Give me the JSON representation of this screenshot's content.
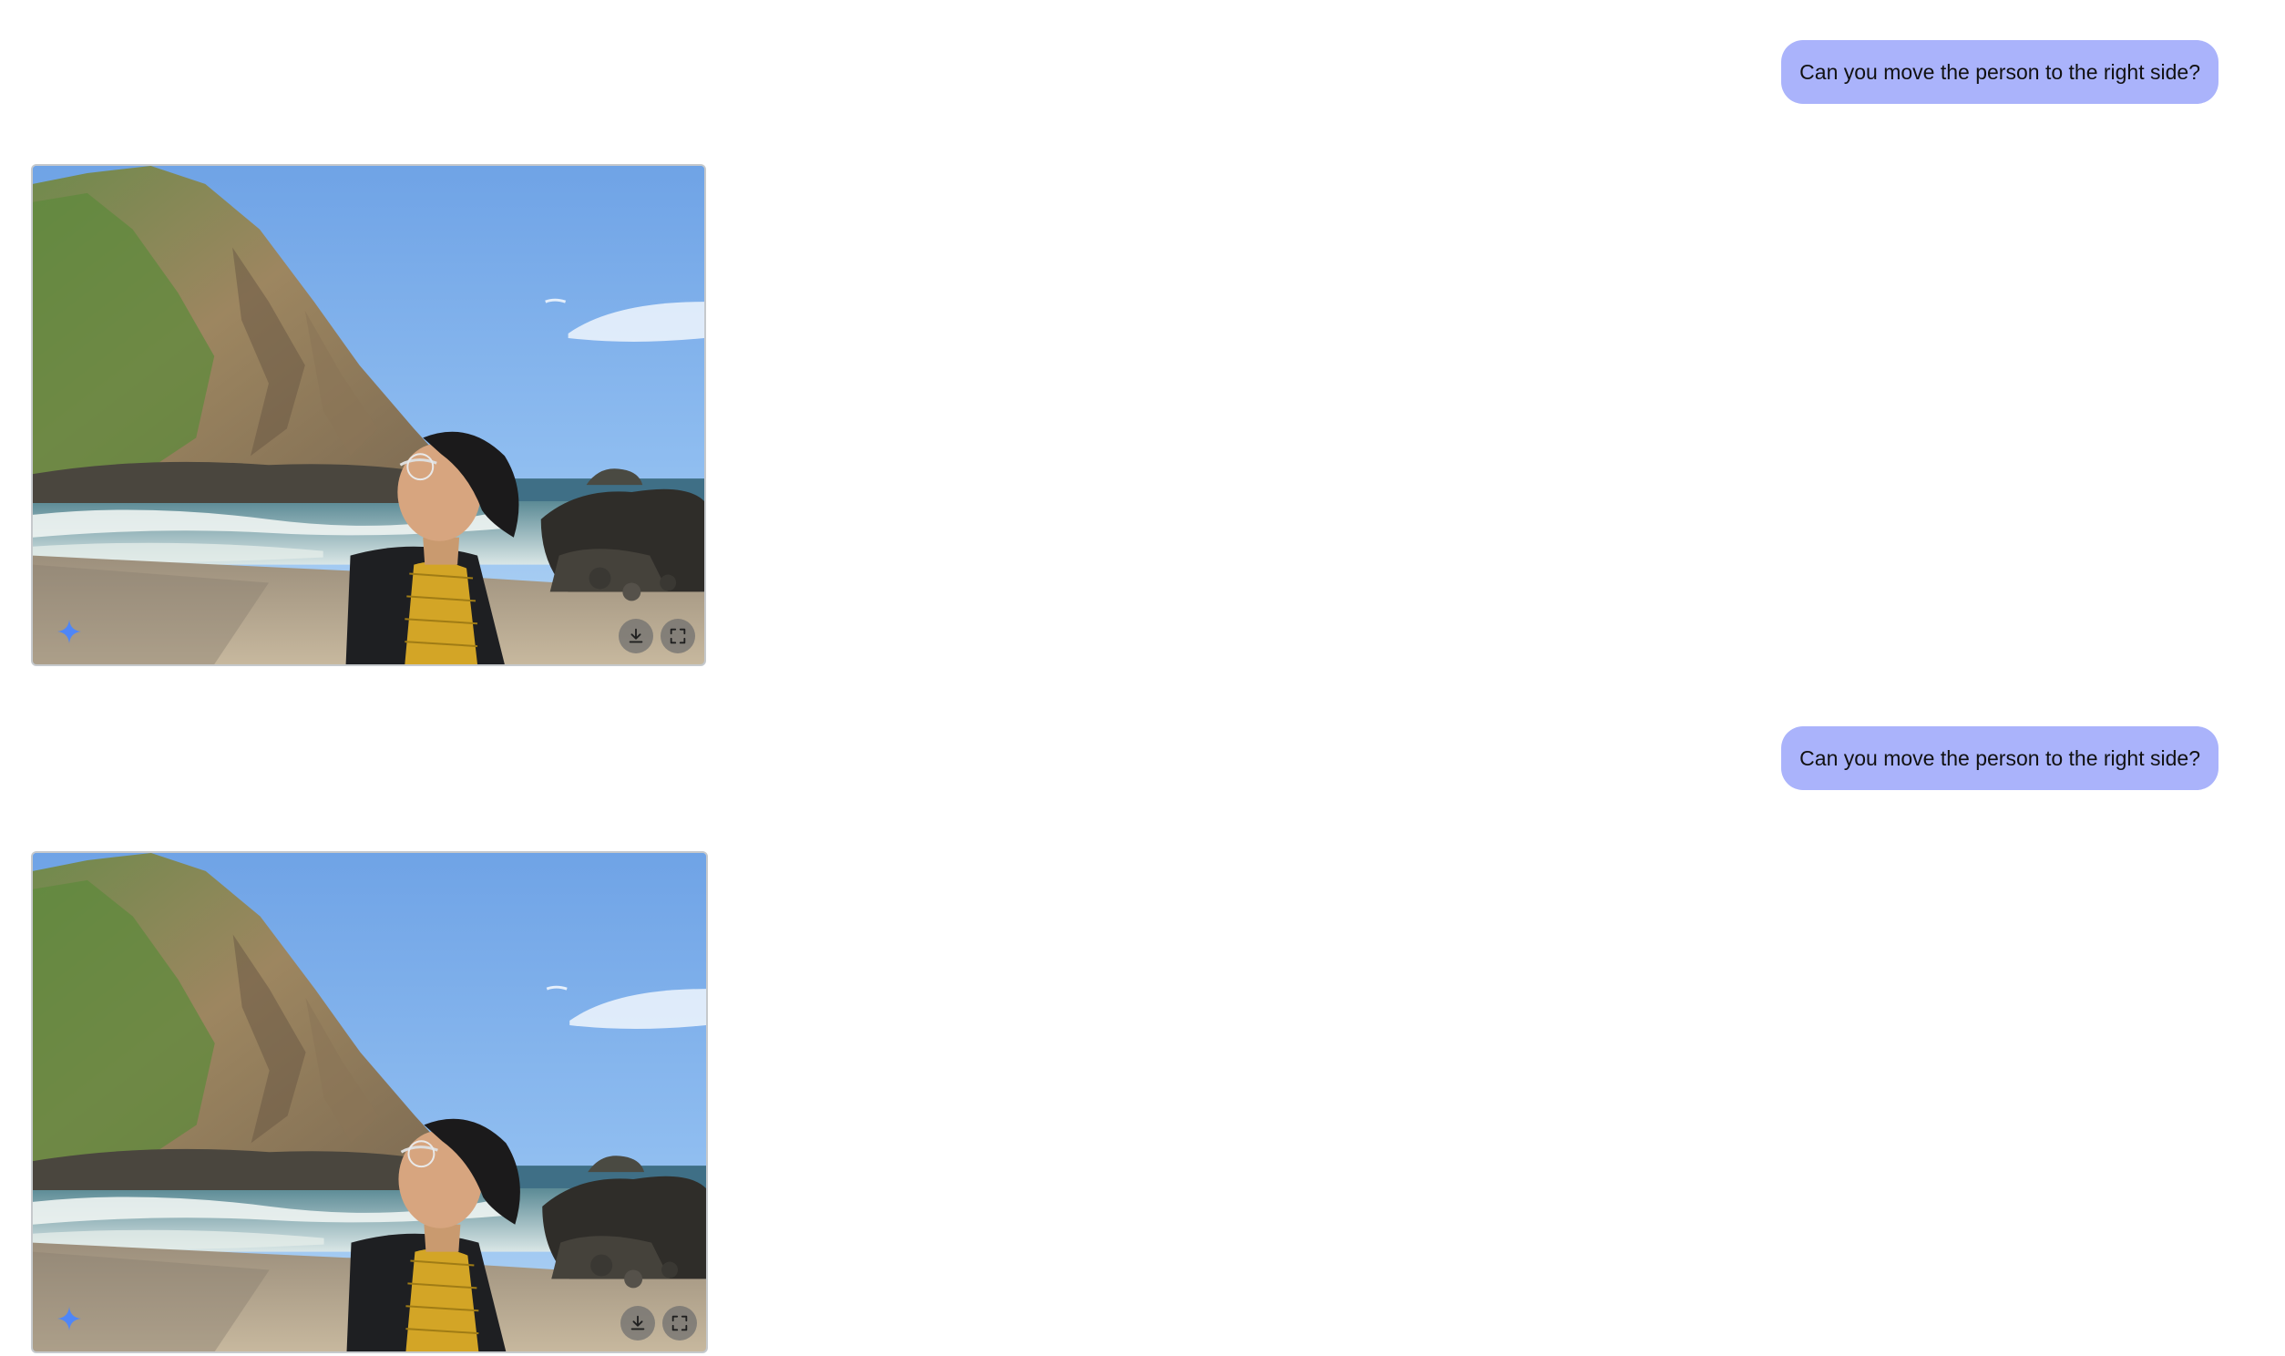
{
  "conversation": {
    "messages": [
      {
        "role": "user",
        "text": "Can you move the person to the right side?"
      },
      {
        "role": "model",
        "image": {
          "icon": "sparkle-icon",
          "actions": [
            "download-icon",
            "fullscreen-icon"
          ]
        }
      },
      {
        "role": "user",
        "text": "Can you move the person to the right side?"
      },
      {
        "role": "model",
        "image": {
          "icon": "sparkle-icon",
          "actions": [
            "download-icon",
            "fullscreen-icon"
          ]
        }
      }
    ]
  },
  "colors": {
    "user_bubble": "#aab3fb",
    "page_background": "#ffffff",
    "sparkle": "#4f86f7"
  }
}
